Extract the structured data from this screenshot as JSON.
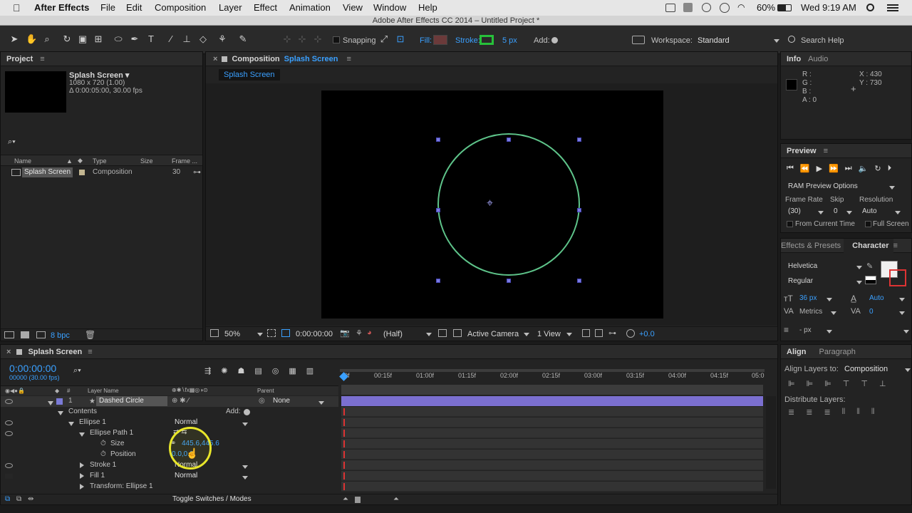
{
  "menubar": {
    "apple": "",
    "items": [
      "After Effects",
      "File",
      "Edit",
      "Composition",
      "Layer",
      "Effect",
      "Animation",
      "View",
      "Window",
      "Help"
    ],
    "battery": "60%",
    "clock": "Wed 9:19 AM"
  },
  "window": {
    "title": "Adobe After Effects CC 2014 – Untitled Project *"
  },
  "toolbar": {
    "snapping": "Snapping",
    "fill_label": "Fill:",
    "stroke_label": "Stroke:",
    "stroke_width": "5 px",
    "add_label": "Add:",
    "workspace_label": "Workspace:",
    "workspace_value": "Standard",
    "search_help": "Search Help",
    "fill_color": "#6b3a3a",
    "stroke_color": "#27c13a"
  },
  "project": {
    "tab": "Project",
    "comp_name": "Splash Screen ▾",
    "comp_size": "1080 x 720 (1.00)",
    "comp_duration": "Δ 0:00:05:00, 30.00 fps",
    "search_placeholder": "",
    "columns": [
      "Name",
      "Type",
      "Size",
      "Frame ..."
    ],
    "items": [
      {
        "name": "Splash Screen",
        "type": "Composition",
        "size": "",
        "frame": "30"
      }
    ],
    "bpc": "8 bpc"
  },
  "composition": {
    "tab_prefix": "Composition",
    "tab_name": "Splash Screen",
    "flow_tab": "Splash Screen",
    "zoom": "50%",
    "timecode": "0:00:00:00",
    "resolution": "(Half)",
    "camera": "Active Camera",
    "views": "1 View",
    "exposure": "+0.0",
    "circle_color": "#5ec48a"
  },
  "info": {
    "tab_info": "Info",
    "tab_audio": "Audio",
    "r": "R :",
    "g": "G :",
    "b": "B :",
    "a": "A : 0",
    "x": "X : 430",
    "y": "Y : 730"
  },
  "preview": {
    "tab": "Preview",
    "ram": "RAM Preview Options",
    "frame_rate_label": "Frame Rate",
    "skip_label": "Skip",
    "resolution_label": "Resolution",
    "frame_rate": "(30)",
    "skip": "0",
    "resolution": "Auto",
    "from_current": "From Current Time",
    "full_screen": "Full Screen"
  },
  "character": {
    "tab_effects": "Effects & Presets",
    "tab_character": "Character",
    "font": "Helvetica",
    "style": "Regular",
    "size": "36 px",
    "leading": "Auto",
    "kerning": "Metrics",
    "tracking": "0",
    "baseline": "- px"
  },
  "align": {
    "tab_align": "Align",
    "tab_paragraph": "Paragraph",
    "align_to_label": "Align Layers to:",
    "align_to_value": "Composition",
    "distribute": "Distribute Layers:"
  },
  "timeline": {
    "tab": "Splash Screen",
    "timecode": "0:00:00:00",
    "frames": "00000 (30.00 fps)",
    "col_layer": "Layer Name",
    "col_parent": "Parent",
    "ruler": [
      "0f",
      "00:15f",
      "01:00f",
      "01:15f",
      "02:00f",
      "02:15f",
      "03:00f",
      "03:15f",
      "04:00f",
      "04:15f",
      "05:0"
    ],
    "layer": {
      "num": "1",
      "name": "Dashed Circle",
      "parent": "None",
      "color": "#7b7bd8"
    },
    "rows": [
      {
        "label": "Contents",
        "value": "Add:"
      },
      {
        "label": "Ellipse 1",
        "value": "Normal"
      },
      {
        "label": "Ellipse Path 1",
        "value": ""
      },
      {
        "label": "Size",
        "value": "445.6,445.6"
      },
      {
        "label": "Position",
        "value": "0.0,0.0"
      },
      {
        "label": "Stroke 1",
        "value": "Normal"
      },
      {
        "label": "Fill 1",
        "value": "Normal"
      },
      {
        "label": "Transform: Ellipse 1",
        "value": ""
      }
    ],
    "toggle": "Toggle Switches / Modes"
  }
}
